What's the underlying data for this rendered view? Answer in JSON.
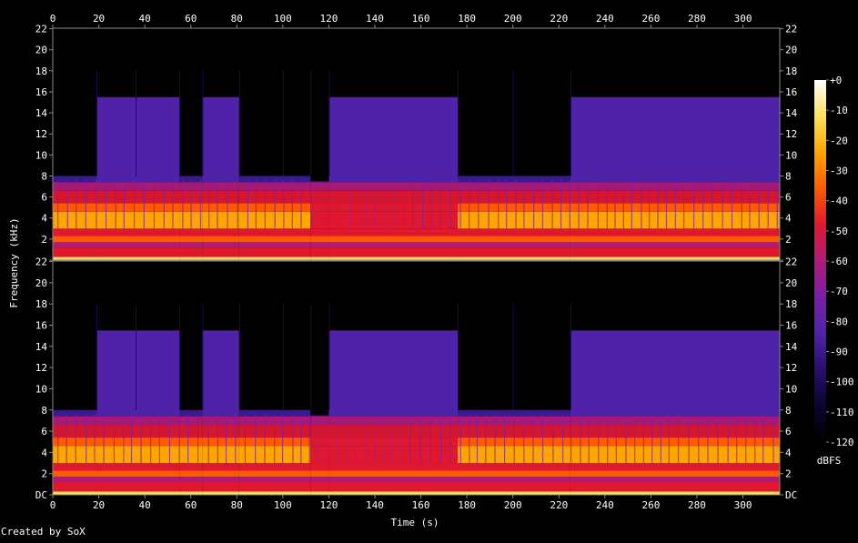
{
  "chart_data": {
    "type": "heatmap",
    "title": "",
    "xlabel": "Time (s)",
    "ylabel": "Frequency (kHz)",
    "xlim": [
      0,
      316
    ],
    "ylim_khz": [
      0,
      22.05
    ],
    "x_ticks": [
      0,
      20,
      40,
      60,
      80,
      100,
      120,
      140,
      160,
      180,
      200,
      220,
      240,
      260,
      280,
      300
    ],
    "y_ticks": [
      {
        "value": 0,
        "label": "DC"
      },
      {
        "value": 2,
        "label": "2"
      },
      {
        "value": 4,
        "label": "4"
      },
      {
        "value": 6,
        "label": "6"
      },
      {
        "value": 8,
        "label": "8"
      },
      {
        "value": 10,
        "label": "10"
      },
      {
        "value": 12,
        "label": "12"
      },
      {
        "value": 14,
        "label": "14"
      },
      {
        "value": 16,
        "label": "16"
      },
      {
        "value": 18,
        "label": "18"
      },
      {
        "value": 20,
        "label": "20"
      },
      {
        "value": 22,
        "label": "22"
      }
    ],
    "channels": 2,
    "colorbar": {
      "label": "dBFS",
      "range": [
        -120,
        0
      ],
      "ticks": [
        "+0",
        "-10",
        "-20",
        "-30",
        "-40",
        "-50",
        "-60",
        "-70",
        "-80",
        "-90",
        "-100",
        "-110",
        "-120"
      ]
    },
    "bandwidth_segments": [
      {
        "start": 0,
        "end": 19,
        "cutoff_khz": 8
      },
      {
        "start": 19,
        "end": 55,
        "cutoff_khz": 15.5
      },
      {
        "start": 55,
        "end": 65,
        "cutoff_khz": 8
      },
      {
        "start": 65,
        "end": 81,
        "cutoff_khz": 15.5
      },
      {
        "start": 81,
        "end": 112,
        "cutoff_khz": 8
      },
      {
        "start": 112,
        "end": 120,
        "cutoff_khz": 7.5
      },
      {
        "start": 120,
        "end": 176,
        "cutoff_khz": 15.5
      },
      {
        "start": 176,
        "end": 225,
        "cutoff_khz": 8
      },
      {
        "start": 225,
        "end": 316,
        "cutoff_khz": 15.5
      }
    ],
    "colors": [
      "#000000",
      "#0a0530",
      "#2a0d6e",
      "#4f23a8",
      "#7a1fa8",
      "#b01a7a",
      "#e0182f",
      "#ff5a00",
      "#ffa500",
      "#ffe15a",
      "#ffffff"
    ]
  },
  "credit": "Created by SoX"
}
